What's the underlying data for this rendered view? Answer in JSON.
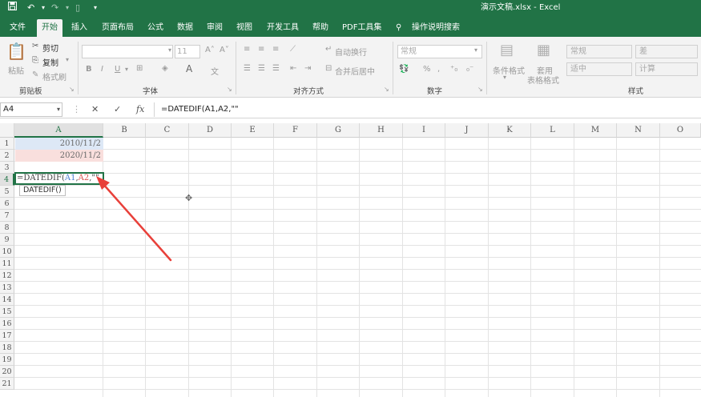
{
  "titlebar": {
    "save_icon": "save-icon",
    "undo_icon": "undo-icon",
    "redo_icon": "redo-icon",
    "title": "演示文稿.xlsx  -  Excel"
  },
  "tabs": [
    "文件",
    "开始",
    "插入",
    "页面布局",
    "公式",
    "数据",
    "审阅",
    "视图",
    "开发工具",
    "帮助",
    "PDF工具集"
  ],
  "tell_me": "操作说明搜索",
  "ribbon": {
    "clipboard": {
      "paste": "粘贴",
      "cut": "剪切",
      "copy": "复制",
      "format_painter": "格式刷",
      "label": "剪贴板"
    },
    "font": {
      "size": "11",
      "bold": "B",
      "italic": "I",
      "underline": "U",
      "font_color": "A",
      "phonetic": "文",
      "label": "字体"
    },
    "alignment": {
      "wrap_text": "自动换行",
      "merge_center": "合并后居中",
      "label": "对齐方式"
    },
    "number": {
      "format": "常规",
      "percent": "%",
      "comma": ",",
      "label": "数字"
    },
    "styles": {
      "conditional": "条件格式",
      "table_format_1": "套用",
      "table_format_2": "表格格式",
      "cells": [
        "常规",
        "差",
        "适中",
        "计算"
      ],
      "label": "样式"
    }
  },
  "formula_bar": {
    "name_box": "A4",
    "cancel": "✕",
    "enter": "✓",
    "fx": "fx",
    "formula": "=DATEDIF(A1,A2,\"\""
  },
  "columns": [
    "A",
    "B",
    "C",
    "D",
    "E",
    "F",
    "G",
    "H",
    "I",
    "J",
    "K",
    "L",
    "M",
    "N",
    "O"
  ],
  "rows": [
    "1",
    "2",
    "3",
    "4",
    "5",
    "6",
    "7",
    "8",
    "9",
    "10",
    "11",
    "12",
    "13",
    "14",
    "15",
    "16",
    "17",
    "18",
    "19",
    "20",
    "21"
  ],
  "cells": {
    "A1": "2010/11/2",
    "A2": "2020/11/2"
  },
  "edit": {
    "prefix": "=DATEDIF(",
    "ref1": "A1",
    "comma1": ",",
    "ref2": "A2",
    "rest": ",\"\""
  },
  "tooltip": "DATEDIF()",
  "colors": {
    "excel_green": "#217346",
    "arrow": "#e8403a"
  }
}
